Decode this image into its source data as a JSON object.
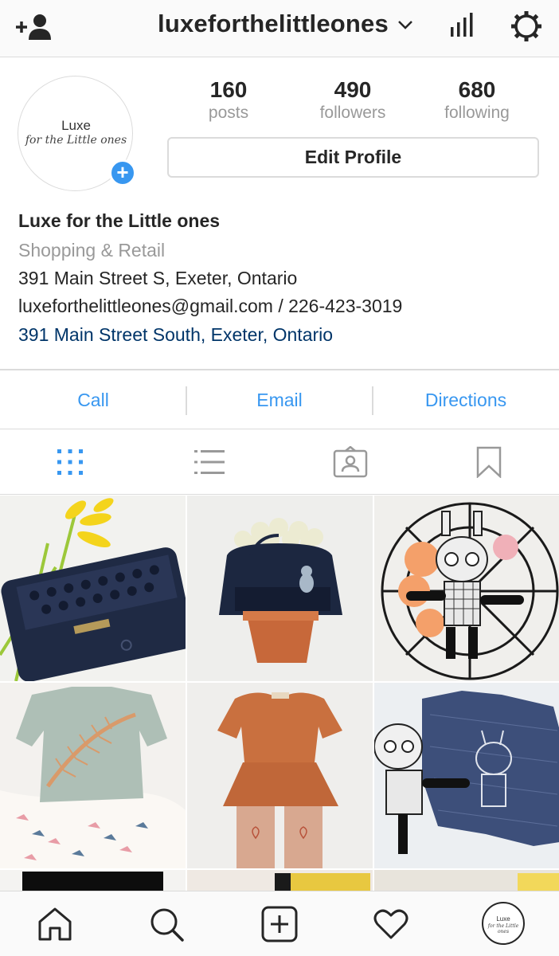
{
  "header": {
    "username": "luxeforthelittleones",
    "icons": [
      "add-user-icon",
      "chevron-down-icon",
      "insights-icon",
      "gear-icon"
    ]
  },
  "profile": {
    "avatar_text_line1": "Luxe",
    "avatar_text_line2": "for the Little ones",
    "avatar_badge": "+",
    "stats": [
      {
        "value": "160",
        "label": "posts"
      },
      {
        "value": "490",
        "label": "followers"
      },
      {
        "value": "680",
        "label": "following"
      }
    ],
    "edit_button": "Edit Profile"
  },
  "bio": {
    "name": "Luxe for the Little ones",
    "category": "Shopping & Retail",
    "address": "391 Main Street S, Exeter, Ontario",
    "contact": "luxeforthelittleones@gmail.com / 226-423-3019",
    "location_link": "391 Main Street South, Exeter, Ontario"
  },
  "actions": [
    "Call",
    "Email",
    "Directions"
  ],
  "tabs": [
    "grid-view-icon",
    "list-view-icon",
    "tagged-icon",
    "saved-icon"
  ],
  "posts": [
    {
      "name": "navy-clutch-with-yellow-lilies"
    },
    {
      "name": "navy-handbag-on-flower-pot"
    },
    {
      "name": "stitched-bunny-doll-in-wire-basket"
    },
    {
      "name": "feather-tshirt-with-bird-skirt"
    },
    {
      "name": "rust-peplum-dress-heart-leggings"
    },
    {
      "name": "bunny-doll-with-blue-romper"
    }
  ],
  "bottom_nav": [
    "home-icon",
    "search-icon",
    "new-post-icon",
    "activity-heart-icon",
    "profile-avatar-icon"
  ],
  "bottom_avatar": {
    "line1": "Luxe",
    "line2": "for the Little ones"
  },
  "colors": {
    "accent": "#3897f0",
    "link": "#003569",
    "muted": "#999999",
    "border": "#dbdbdb"
  }
}
